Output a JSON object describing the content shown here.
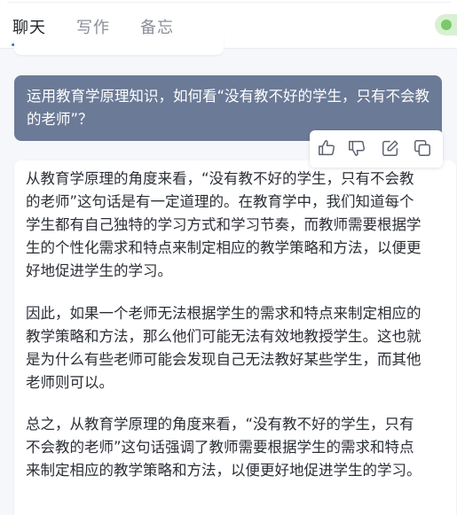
{
  "tabs": [
    "聊天",
    "写作",
    "备忘"
  ],
  "user_message": "运用教育学原理知识，如何看“没有教不好的学生，只有不会教的老师”？",
  "actions": [
    "thumbs-up-icon",
    "thumbs-down-icon",
    "edit-icon",
    "copy-icon"
  ],
  "answer": {
    "paragraphs": [
      "从教育学原理的角度来看，“没有教不好的学生，只有不会教的老师”这句话是有一定道理的。在教育学中，我们知道每个学生都有自己独特的学习方式和学习节奏，而教师需要根据学生的个性化需求和特点来制定相应的教学策略和方法，以便更好地促进学生的学习。",
      "因此，如果一个老师无法根据学生的需求和特点来制定相应的教学策略和方法，那么他们可能无法有效地教授学生。这也就是为什么有些老师可能会发现自己无法教好某些学生，而其他老师则可以。",
      "总之，从教育学原理的角度来看，“没有教不好的学生，只有不会教的老师”这句话强调了教师需要根据学生的需求和特点来制定相应的教学策略和方法，以便更好地促进学生的学习。"
    ]
  },
  "colors": {
    "user_bubble": "#6b7a96",
    "tab_active_underline": "#4a78d4",
    "toggle": "#7cc96a"
  }
}
